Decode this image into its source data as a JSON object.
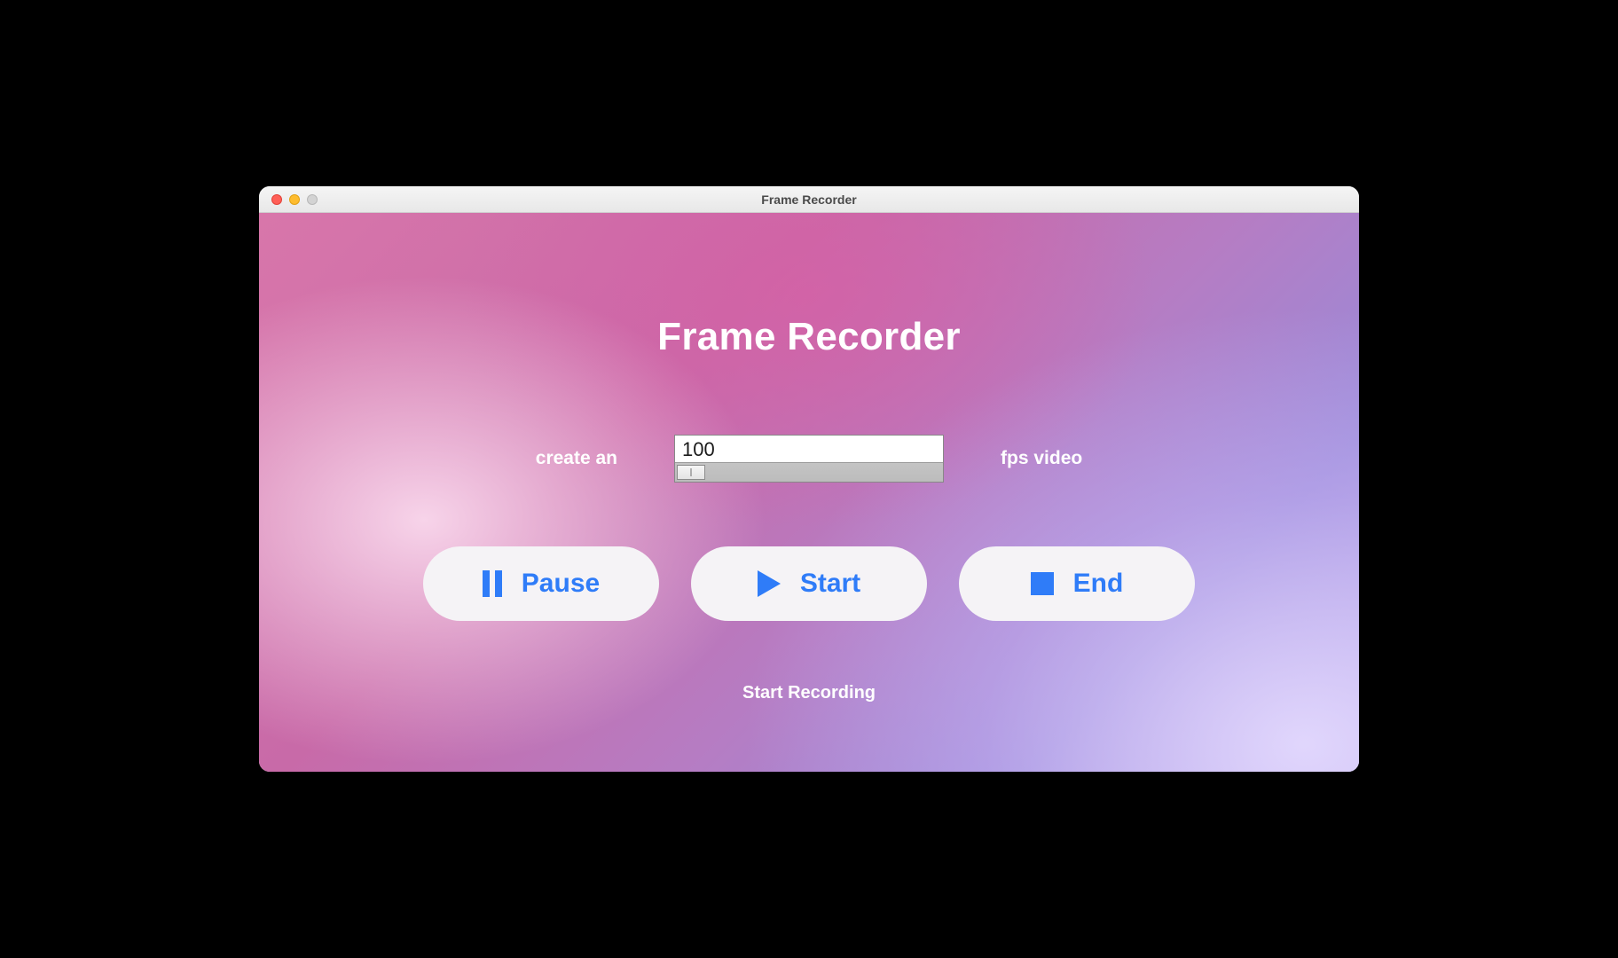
{
  "window": {
    "title": "Frame Recorder"
  },
  "app": {
    "title": "Frame Recorder"
  },
  "fps": {
    "prefix": "create an",
    "value": "100",
    "suffix": "fps video"
  },
  "buttons": {
    "pause": "Pause",
    "start": "Start",
    "end": "End"
  },
  "status": "Start Recording"
}
